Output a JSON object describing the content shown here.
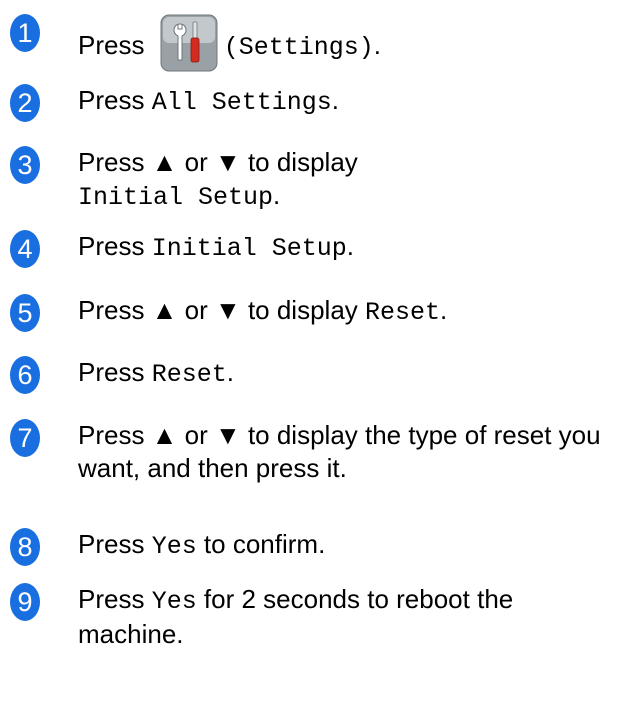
{
  "steps": [
    {
      "n": "1",
      "parts": [
        [
          "t",
          "Press "
        ],
        [
          "icon",
          "settings-icon"
        ],
        [
          "m",
          "(Settings)"
        ],
        [
          "t",
          "."
        ]
      ]
    },
    {
      "n": "2",
      "parts": [
        [
          "t",
          "Press "
        ],
        [
          "m",
          "All Settings"
        ],
        [
          "t",
          "."
        ]
      ]
    },
    {
      "n": "3",
      "parts": [
        [
          "t",
          "Press ▲ or ▼ to display"
        ],
        [
          "br",
          ""
        ],
        [
          "m",
          "Initial Setup"
        ],
        [
          "t",
          "."
        ]
      ]
    },
    {
      "n": "4",
      "parts": [
        [
          "t",
          "Press "
        ],
        [
          "m",
          "Initial Setup"
        ],
        [
          "t",
          "."
        ]
      ]
    },
    {
      "n": "5",
      "parts": [
        [
          "t",
          "Press ▲ or ▼ to display "
        ],
        [
          "m",
          "Reset"
        ],
        [
          "t",
          "."
        ]
      ]
    },
    {
      "n": "6",
      "parts": [
        [
          "t",
          "Press "
        ],
        [
          "m",
          "Reset"
        ],
        [
          "t",
          "."
        ]
      ]
    },
    {
      "n": "7",
      "parts": [
        [
          "t",
          "Press ▲ or ▼ to display the type of reset you want, and then press it."
        ]
      ]
    },
    {
      "n": "8",
      "parts": [
        [
          "t",
          "Press "
        ],
        [
          "m",
          "Yes"
        ],
        [
          "t",
          " to confirm."
        ]
      ]
    },
    {
      "n": "9",
      "parts": [
        [
          "t",
          "Press "
        ],
        [
          "m",
          "Yes"
        ],
        [
          "t",
          " for 2 seconds to reboot the machine."
        ]
      ]
    }
  ],
  "colors": {
    "step_badge": "#1a6fe0"
  }
}
